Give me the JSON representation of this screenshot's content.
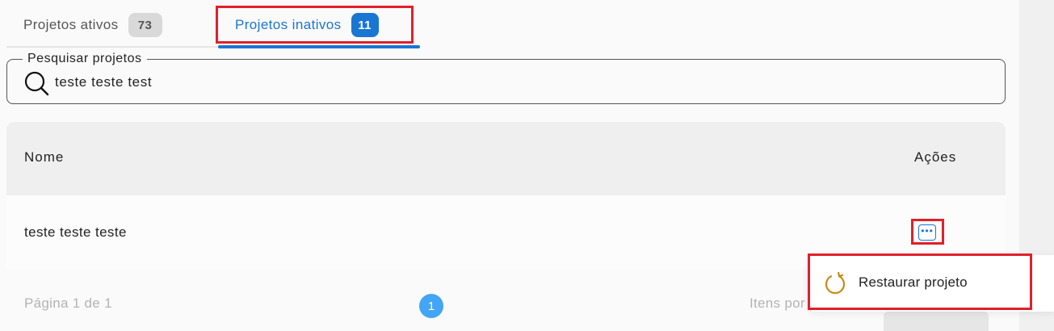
{
  "tabs": [
    {
      "label": "Projetos ativos",
      "count": "73"
    },
    {
      "label": "Projetos inativos",
      "count": "11",
      "active": true
    }
  ],
  "search": {
    "legend": "Pesquisar projetos",
    "value": "teste teste test",
    "icon": "search-icon"
  },
  "table": {
    "headers": {
      "name": "Nome",
      "actions": "Ações"
    },
    "rows": [
      {
        "name": "teste teste teste",
        "actions_icon": "more-horizontal-icon"
      }
    ]
  },
  "pagination": {
    "info": "Página 1 de 1",
    "current_page": "1",
    "items_label": "Itens por p"
  },
  "actions_menu": {
    "items": [
      {
        "label": "Restaurar projeto",
        "icon": "restore-icon"
      }
    ]
  },
  "colors": {
    "accent": "#1976d2",
    "highlight": "#e0202a",
    "restore_icon": "#c98a1a",
    "page_button": "#42a5f5"
  }
}
